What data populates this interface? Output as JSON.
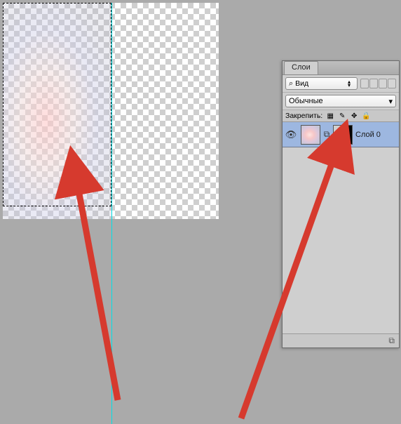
{
  "panel": {
    "tab_label": "Слои",
    "kind_label": "Вид",
    "blend_mode": "Обычные",
    "lock_label": "Закрепить:"
  },
  "layer": {
    "name": "Слой 0"
  },
  "icons": {
    "search": "⌕",
    "up": "▴",
    "down": "▾",
    "dropdown": "▾",
    "checker": "▦",
    "brush": "✎",
    "move": "✥",
    "lock": "🔒",
    "eye": "👁",
    "link": "⧉",
    "link_footer": "⧉"
  }
}
